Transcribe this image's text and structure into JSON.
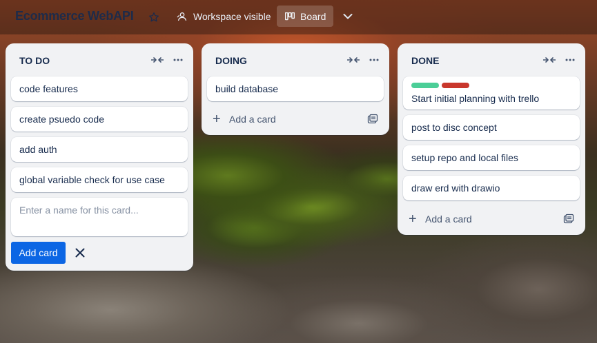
{
  "header": {
    "board_title": "Ecommerce WebAPI",
    "star_icon": "star-outline-icon",
    "visibility_label": "Workspace visible",
    "visibility_icon": "people-icon",
    "view_label": "Board",
    "view_icon": "board-icon",
    "view_menu_icon": "chevron-down-icon"
  },
  "lists": [
    {
      "title": "TO DO",
      "cards": [
        "code features",
        "create psuedo code",
        "add auth",
        "global variable check for use case"
      ],
      "composer_placeholder": "Enter a name for this card...",
      "add_button_label": "Add card"
    },
    {
      "title": "DOING",
      "cards": [
        "build database"
      ],
      "add_card_label": "Add a card"
    },
    {
      "title": "DONE",
      "cards": [
        "Start initial planning with trello",
        "post to disc concept",
        "setup repo and local files",
        "draw erd with drawio"
      ],
      "first_card_labels": [
        {
          "color": "#4bce97"
        },
        {
          "color": "#c9372c"
        }
      ],
      "add_card_label": "Add a card"
    }
  ],
  "colors": {
    "list_bg": "#f1f2f4",
    "primary_button": "#0c66e4",
    "text": "#172b4d",
    "title": "#1d2b4a"
  }
}
